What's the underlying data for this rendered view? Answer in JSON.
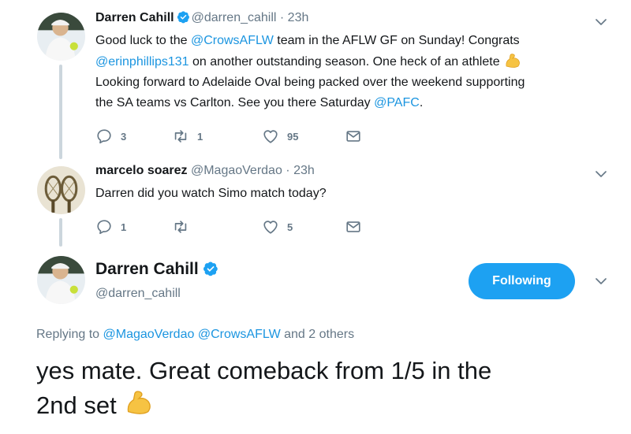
{
  "tweet1": {
    "name": "Darren Cahill",
    "handle": "@darren_cahill",
    "time": " · 23h",
    "text_part1": "Good luck to the ",
    "link1": "@CrowsAFLW",
    "text_part2": " team in the AFLW GF on Sunday! Congrats",
    "link2": "@erinphillips131",
    "text_part3": " on another outstanding season. One heck of an athlete ",
    "text_part4": " Looking forward to Adelaide Oval being packed over the weekend supporting",
    "text_part5": "the SA teams vs Carlton. See you there Saturday ",
    "link3": "@PAFC",
    "text_part6": ".",
    "replies": "3",
    "retweets": "1",
    "likes": "95"
  },
  "tweet2": {
    "name": "marcelo soarez",
    "handle": "@MagaoVerdao",
    "time": " · 23h",
    "text": "Darren did you watch Simo match today?",
    "replies": "1",
    "retweets": "",
    "likes": "5"
  },
  "main_tweet": {
    "name": "Darren Cahill",
    "handle": "@darren_cahill",
    "follow_label": "Following",
    "replying_prefix": "Replying to ",
    "reply_to_1": "@MagaoVerdao",
    "reply_to_2": "@CrowsAFLW",
    "reply_suffix": " and 2 others",
    "text_line1": "yes mate. Great comeback from 1/5 in the",
    "text_line2": "2nd set "
  },
  "icons": {
    "reply": "reply-icon",
    "retweet": "retweet-icon",
    "like": "heart-icon",
    "dm": "envelope-icon",
    "verified": "verified-badge-icon",
    "caret": "chevron-down-icon",
    "emoji": "flexed-biceps-emoji"
  },
  "colors": {
    "link": "#1b95e0",
    "button": "#1da1f2",
    "secondary_text": "#657786",
    "thread_line": "#ccd6dd"
  }
}
